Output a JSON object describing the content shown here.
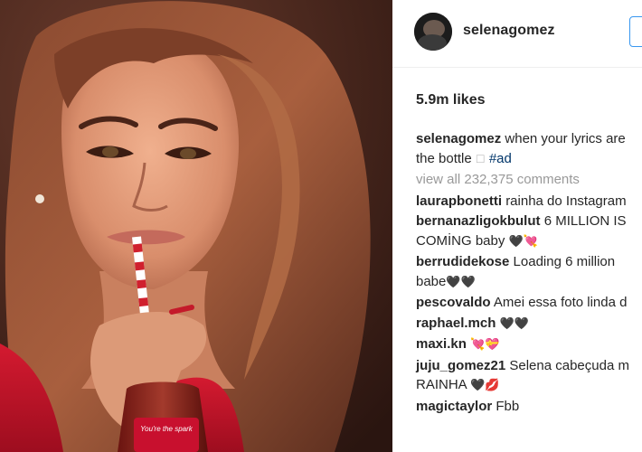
{
  "post": {
    "username": "selenagomez",
    "likes": "5.9m likes",
    "caption": {
      "user": "selenagomez",
      "text_line1": "when your lyrics are",
      "text_line2": "the bottle",
      "glyph": "☐",
      "hashtag": "#ad"
    },
    "view_all": "view all 232,375 comments",
    "comments": [
      {
        "user": "laurapbonetti",
        "text": "rainha do Instagram"
      },
      {
        "user": "bernanazligokbulut",
        "text": "6 MILLION IS",
        "text2": "COMİNG baby",
        "emoji": "🖤💘"
      },
      {
        "user": "berrudidekose",
        "text": "Loading 6 million",
        "text2": "babe",
        "emoji": "🖤🖤"
      },
      {
        "user": "pescovaldo",
        "text": "Amei essa foto linda d"
      },
      {
        "user": "raphael.mch",
        "text": "",
        "emoji": "🖤🖤"
      },
      {
        "user": "maxi.kn",
        "text": "",
        "emoji": "💘💝"
      },
      {
        "user": "juju_gomez21",
        "text": "Selena cabeçuda m",
        "text2": "RAINHA",
        "emoji": "🖤💋"
      },
      {
        "user": "magictaylor",
        "text": "Fbb"
      }
    ],
    "bottle_text": "You're the spark",
    "colors": {
      "accent_blue": "#3897f0",
      "hashtag_blue": "#003569",
      "muted_gray": "#999999",
      "dress_red": "#c8102e"
    }
  }
}
